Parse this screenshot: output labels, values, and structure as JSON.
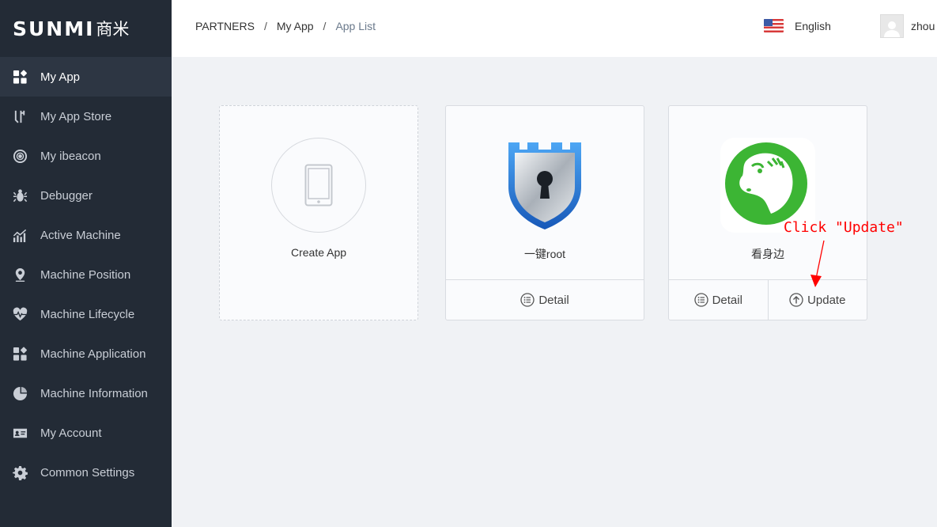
{
  "app": {
    "logo": "SUNMI",
    "logo_cn": "商米"
  },
  "sidebar": {
    "items": [
      {
        "label": "My App",
        "icon": "apps-icon",
        "active": true
      },
      {
        "label": "My App Store",
        "icon": "store-icon"
      },
      {
        "label": "My ibeacon",
        "icon": "beacon-icon"
      },
      {
        "label": "Debugger",
        "icon": "bug-icon"
      },
      {
        "label": "Active Machine",
        "icon": "chart-icon"
      },
      {
        "label": "Machine Position",
        "icon": "location-pin-icon"
      },
      {
        "label": "Machine Lifecycle",
        "icon": "heartbeat-icon"
      },
      {
        "label": "Machine Application",
        "icon": "apps-icon"
      },
      {
        "label": "Machine Information",
        "icon": "pie-chart-icon"
      },
      {
        "label": "My Account",
        "icon": "id-card-icon"
      },
      {
        "label": "Common Settings",
        "icon": "gear-icon"
      }
    ]
  },
  "header": {
    "breadcrumb": [
      "PARTNERS",
      "My App",
      "App List"
    ],
    "separator": "/",
    "language": "English",
    "username": "zhou"
  },
  "cards": [
    {
      "name": "Create App",
      "type": "create"
    },
    {
      "name": "一键root",
      "type": "app",
      "icon": "shield-keyhole-icon",
      "buttons": [
        "Detail"
      ]
    },
    {
      "name": "看身边",
      "type": "app",
      "icon": "horse-icon",
      "buttons": [
        "Detail",
        "Update"
      ]
    }
  ],
  "annotation": {
    "text": "Click \"Update\"",
    "color": "#ff0000"
  },
  "colors": {
    "sidebar_bg": "#232b36",
    "sidebar_active": "#2d3643",
    "content_bg": "#f0f2f5",
    "app_green": "#3cb534",
    "shield_blue": "#1e6fd0"
  }
}
